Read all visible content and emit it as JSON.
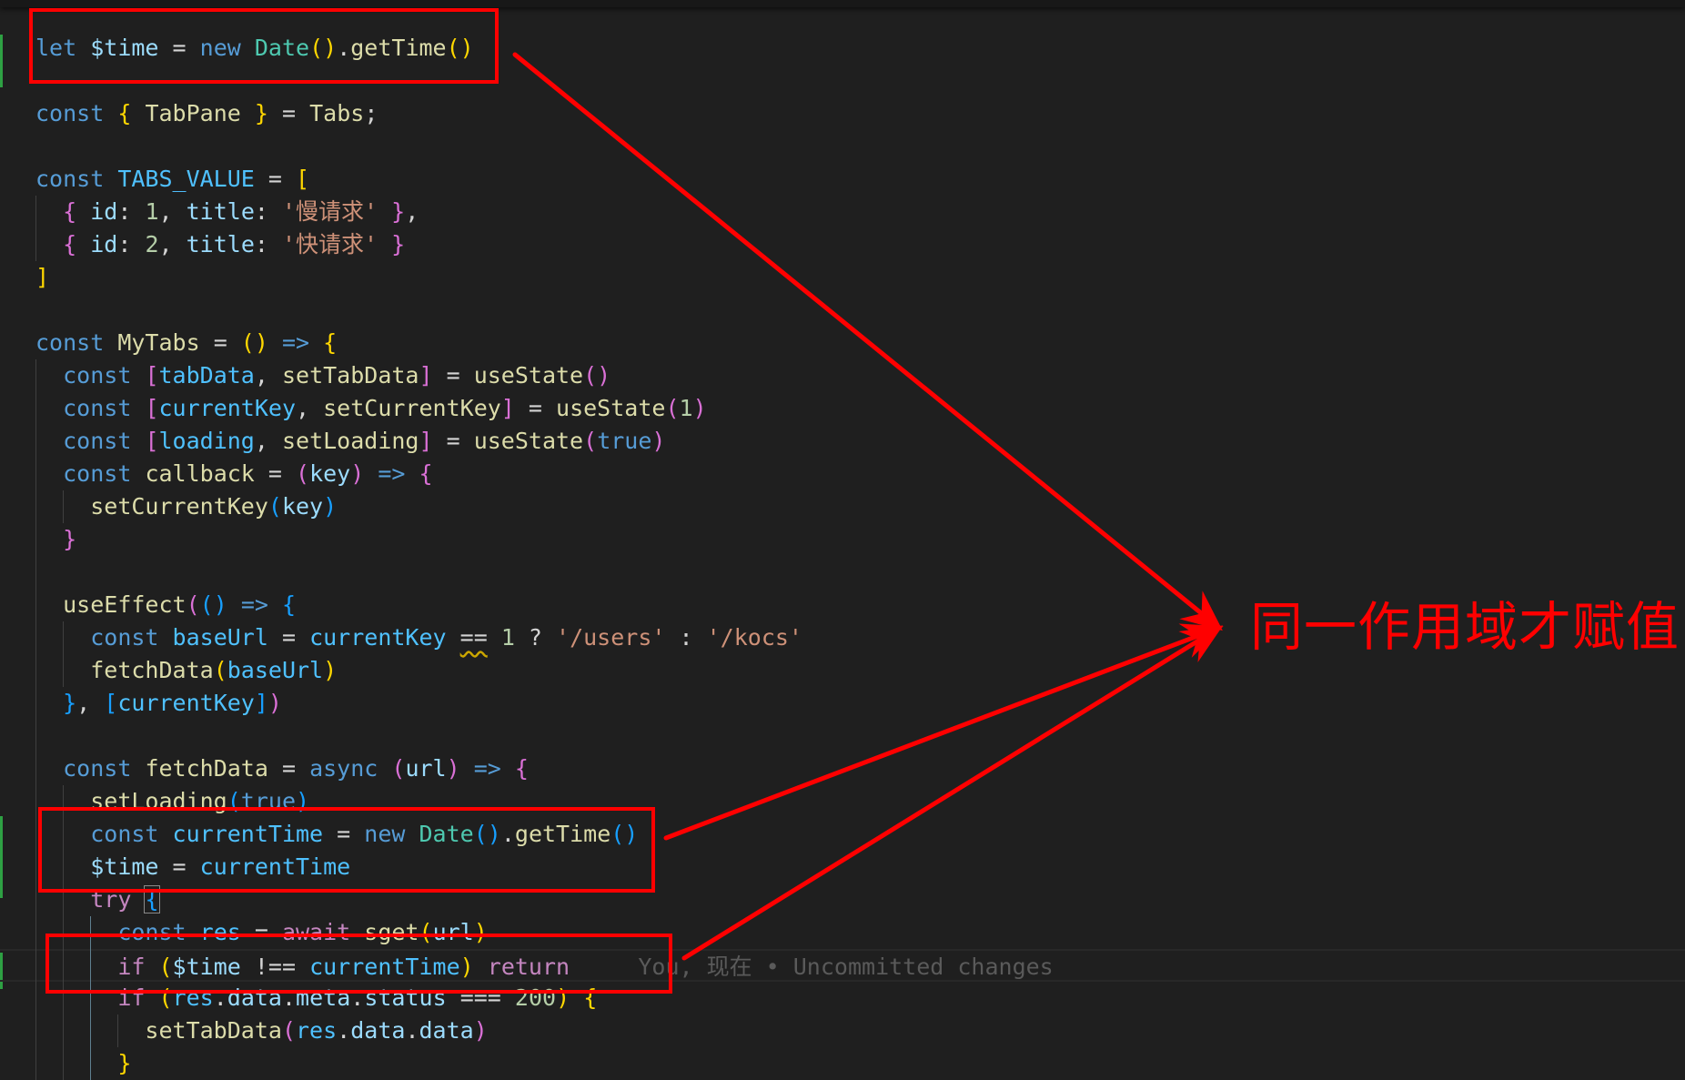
{
  "editor": {
    "theme": "dark",
    "lines": [
      {
        "indent": 0,
        "tokens": [
          [
            "kw",
            "let"
          ],
          [
            "op",
            " "
          ],
          [
            "var",
            "$time"
          ],
          [
            "op",
            " = "
          ],
          [
            "kw",
            "new"
          ],
          [
            "op",
            " "
          ],
          [
            "cls",
            "Date"
          ],
          [
            "p1",
            "()"
          ],
          [
            "op",
            "."
          ],
          [
            "fn",
            "getTime"
          ],
          [
            "p1",
            "()"
          ]
        ]
      },
      {
        "indent": 0,
        "tokens": []
      },
      {
        "indent": 0,
        "tokens": [
          [
            "kw",
            "const"
          ],
          [
            "op",
            " "
          ],
          [
            "p1",
            "{"
          ],
          [
            "op",
            " "
          ],
          [
            "fn",
            "TabPane"
          ],
          [
            "op",
            " "
          ],
          [
            "p1",
            "}"
          ],
          [
            "op",
            " = "
          ],
          [
            "fn",
            "Tabs"
          ],
          [
            "op",
            ";"
          ]
        ]
      },
      {
        "indent": 0,
        "tokens": []
      },
      {
        "indent": 0,
        "tokens": [
          [
            "kw",
            "const"
          ],
          [
            "op",
            " "
          ],
          [
            "const",
            "TABS_VALUE"
          ],
          [
            "op",
            " = "
          ],
          [
            "p1",
            "["
          ]
        ]
      },
      {
        "indent": 1,
        "tokens": [
          [
            "p2",
            "{"
          ],
          [
            "op",
            " "
          ],
          [
            "var",
            "id"
          ],
          [
            "op",
            ": "
          ],
          [
            "num",
            "1"
          ],
          [
            "op",
            ", "
          ],
          [
            "var",
            "title"
          ],
          [
            "op",
            ": "
          ],
          [
            "str",
            "'慢请求'"
          ],
          [
            "op",
            " "
          ],
          [
            "p2",
            "}"
          ],
          [
            "op",
            ","
          ]
        ]
      },
      {
        "indent": 1,
        "tokens": [
          [
            "p2",
            "{"
          ],
          [
            "op",
            " "
          ],
          [
            "var",
            "id"
          ],
          [
            "op",
            ": "
          ],
          [
            "num",
            "2"
          ],
          [
            "op",
            ", "
          ],
          [
            "var",
            "title"
          ],
          [
            "op",
            ": "
          ],
          [
            "str",
            "'快请求'"
          ],
          [
            "op",
            " "
          ],
          [
            "p2",
            "}"
          ]
        ]
      },
      {
        "indent": 0,
        "tokens": [
          [
            "p1",
            "]"
          ]
        ]
      },
      {
        "indent": 0,
        "tokens": []
      },
      {
        "indent": 0,
        "tokens": [
          [
            "kw",
            "const"
          ],
          [
            "op",
            " "
          ],
          [
            "fn",
            "MyTabs"
          ],
          [
            "op",
            " = "
          ],
          [
            "p1",
            "()"
          ],
          [
            "op",
            " "
          ],
          [
            "kw",
            "=>"
          ],
          [
            "op",
            " "
          ],
          [
            "p1",
            "{"
          ]
        ]
      },
      {
        "indent": 1,
        "tokens": [
          [
            "kw",
            "const"
          ],
          [
            "op",
            " "
          ],
          [
            "p2",
            "["
          ],
          [
            "const",
            "tabData"
          ],
          [
            "op",
            ", "
          ],
          [
            "fn",
            "setTabData"
          ],
          [
            "p2",
            "]"
          ],
          [
            "op",
            " = "
          ],
          [
            "fn",
            "useState"
          ],
          [
            "p2",
            "()"
          ]
        ]
      },
      {
        "indent": 1,
        "tokens": [
          [
            "kw",
            "const"
          ],
          [
            "op",
            " "
          ],
          [
            "p2",
            "["
          ],
          [
            "const",
            "currentKey"
          ],
          [
            "op",
            ", "
          ],
          [
            "fn",
            "setCurrentKey"
          ],
          [
            "p2",
            "]"
          ],
          [
            "op",
            " = "
          ],
          [
            "fn",
            "useState"
          ],
          [
            "p2",
            "("
          ],
          [
            "num",
            "1"
          ],
          [
            "p2",
            ")"
          ]
        ]
      },
      {
        "indent": 1,
        "tokens": [
          [
            "kw",
            "const"
          ],
          [
            "op",
            " "
          ],
          [
            "p2",
            "["
          ],
          [
            "const",
            "loading"
          ],
          [
            "op",
            ", "
          ],
          [
            "fn",
            "setLoading"
          ],
          [
            "p2",
            "]"
          ],
          [
            "op",
            " = "
          ],
          [
            "fn",
            "useState"
          ],
          [
            "p2",
            "("
          ],
          [
            "kw",
            "true"
          ],
          [
            "p2",
            ")"
          ]
        ]
      },
      {
        "indent": 1,
        "tokens": [
          [
            "kw",
            "const"
          ],
          [
            "op",
            " "
          ],
          [
            "fn",
            "callback"
          ],
          [
            "op",
            " = "
          ],
          [
            "p2",
            "("
          ],
          [
            "var",
            "key"
          ],
          [
            "p2",
            ")"
          ],
          [
            "op",
            " "
          ],
          [
            "kw",
            "=>"
          ],
          [
            "op",
            " "
          ],
          [
            "p2",
            "{"
          ]
        ]
      },
      {
        "indent": 2,
        "tokens": [
          [
            "fn",
            "setCurrentKey"
          ],
          [
            "p3",
            "("
          ],
          [
            "var",
            "key"
          ],
          [
            "p3",
            ")"
          ]
        ]
      },
      {
        "indent": 1,
        "tokens": [
          [
            "p2",
            "}"
          ]
        ]
      },
      {
        "indent": 0,
        "tokens": []
      },
      {
        "indent": 1,
        "tokens": [
          [
            "fn",
            "useEffect"
          ],
          [
            "p2",
            "("
          ],
          [
            "p3",
            "()"
          ],
          [
            "op",
            " "
          ],
          [
            "kw",
            "=>"
          ],
          [
            "op",
            " "
          ],
          [
            "p3",
            "{"
          ]
        ]
      },
      {
        "indent": 2,
        "tokens": [
          [
            "kw",
            "const"
          ],
          [
            "op",
            " "
          ],
          [
            "const",
            "baseUrl"
          ],
          [
            "op",
            " = "
          ],
          [
            "const",
            "currentKey"
          ],
          [
            "op",
            " "
          ],
          [
            "squig",
            "=="
          ],
          [
            "op",
            " "
          ],
          [
            "num",
            "1"
          ],
          [
            "op",
            " ? "
          ],
          [
            "str",
            "'/users'"
          ],
          [
            "op",
            " : "
          ],
          [
            "str",
            "'/kocs'"
          ]
        ]
      },
      {
        "indent": 2,
        "tokens": [
          [
            "fn",
            "fetchData"
          ],
          [
            "p1",
            "("
          ],
          [
            "const",
            "baseUrl"
          ],
          [
            "p1",
            ")"
          ]
        ]
      },
      {
        "indent": 1,
        "tokens": [
          [
            "p3",
            "}"
          ],
          [
            "op",
            ", "
          ],
          [
            "p3",
            "["
          ],
          [
            "const",
            "currentKey"
          ],
          [
            "p3",
            "]"
          ],
          [
            "p2",
            ")"
          ]
        ]
      },
      {
        "indent": 0,
        "tokens": []
      },
      {
        "indent": 1,
        "tokens": [
          [
            "kw",
            "const"
          ],
          [
            "op",
            " "
          ],
          [
            "fn",
            "fetchData"
          ],
          [
            "op",
            " = "
          ],
          [
            "kw",
            "async"
          ],
          [
            "op",
            " "
          ],
          [
            "p2",
            "("
          ],
          [
            "var",
            "url"
          ],
          [
            "p2",
            ")"
          ],
          [
            "op",
            " "
          ],
          [
            "kw",
            "=>"
          ],
          [
            "op",
            " "
          ],
          [
            "p2",
            "{"
          ]
        ]
      },
      {
        "indent": 2,
        "tokens": [
          [
            "fn",
            "setLoading"
          ],
          [
            "p3",
            "("
          ],
          [
            "kw",
            "true"
          ],
          [
            "p3",
            ")"
          ]
        ]
      },
      {
        "indent": 2,
        "tokens": [
          [
            "kw",
            "const"
          ],
          [
            "op",
            " "
          ],
          [
            "const",
            "currentTime"
          ],
          [
            "op",
            " = "
          ],
          [
            "kw",
            "new"
          ],
          [
            "op",
            " "
          ],
          [
            "cls",
            "Date"
          ],
          [
            "p3",
            "()"
          ],
          [
            "op",
            "."
          ],
          [
            "fn",
            "getTime"
          ],
          [
            "p3",
            "()"
          ]
        ]
      },
      {
        "indent": 2,
        "tokens": [
          [
            "var",
            "$time"
          ],
          [
            "op",
            " = "
          ],
          [
            "const",
            "currentTime"
          ]
        ]
      },
      {
        "indent": 2,
        "tokens": [
          [
            "kw2",
            "try"
          ],
          [
            "op",
            " "
          ],
          [
            "cursor",
            "{"
          ]
        ]
      },
      {
        "indent": 3,
        "tokens": [
          [
            "kw",
            "const"
          ],
          [
            "op",
            " "
          ],
          [
            "const",
            "res"
          ],
          [
            "op",
            " = "
          ],
          [
            "kw2",
            "await"
          ],
          [
            "op",
            " "
          ],
          [
            "fn",
            "sget"
          ],
          [
            "p1",
            "("
          ],
          [
            "var",
            "url"
          ],
          [
            "p1",
            ")"
          ]
        ]
      },
      {
        "indent": 3,
        "current": true,
        "tokens": [
          [
            "kw2",
            "if"
          ],
          [
            "op",
            " "
          ],
          [
            "p1",
            "("
          ],
          [
            "var",
            "$time"
          ],
          [
            "op",
            " !== "
          ],
          [
            "const",
            "currentTime"
          ],
          [
            "p1",
            ")"
          ],
          [
            "op",
            " "
          ],
          [
            "kw2",
            "return"
          ]
        ],
        "blame": "You, 现在 • Uncommitted changes"
      },
      {
        "indent": 3,
        "tokens": [
          [
            "kw2",
            "if"
          ],
          [
            "op",
            " "
          ],
          [
            "p1",
            "("
          ],
          [
            "const",
            "res"
          ],
          [
            "op",
            "."
          ],
          [
            "var",
            "data"
          ],
          [
            "op",
            "."
          ],
          [
            "var",
            "meta"
          ],
          [
            "op",
            "."
          ],
          [
            "var",
            "status"
          ],
          [
            "op",
            " === "
          ],
          [
            "num",
            "200"
          ],
          [
            "p1",
            ")"
          ],
          [
            "op",
            " "
          ],
          [
            "p1",
            "{"
          ]
        ]
      },
      {
        "indent": 4,
        "tokens": [
          [
            "fn",
            "setTabData"
          ],
          [
            "p2",
            "("
          ],
          [
            "const",
            "res"
          ],
          [
            "op",
            "."
          ],
          [
            "var",
            "data"
          ],
          [
            "op",
            "."
          ],
          [
            "var",
            "data"
          ],
          [
            "p2",
            ")"
          ]
        ]
      },
      {
        "indent": 3,
        "tokens": [
          [
            "p1",
            "}"
          ]
        ]
      }
    ]
  },
  "annotation": {
    "label": "同一作用域才赋值",
    "color": "#ff0000",
    "highlighted_lines": [
      "let $time = new Date().getTime()",
      "const currentTime = new Date().getTime() / $time = currentTime",
      "if ($time !== currentTime) return"
    ]
  }
}
